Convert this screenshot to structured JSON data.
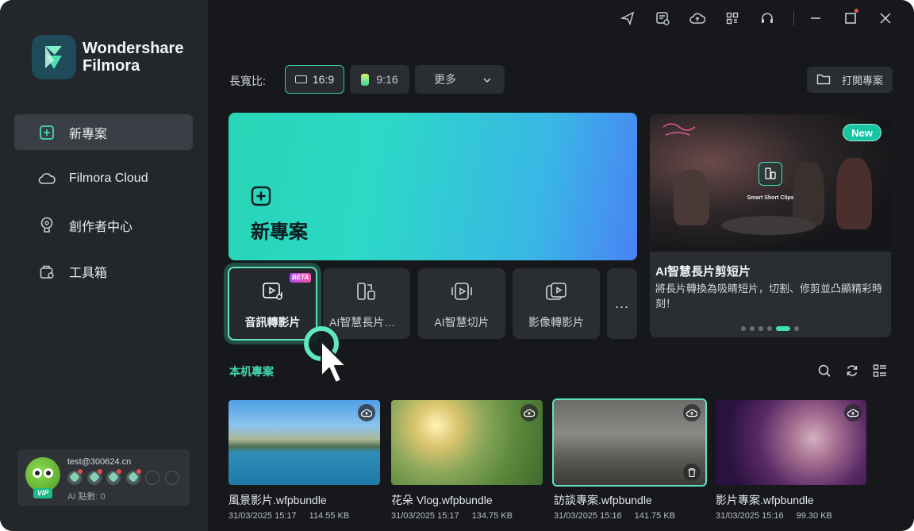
{
  "app": {
    "brand_line1": "Wondershare",
    "brand_line2": "Filmora"
  },
  "sidebar": {
    "items": [
      {
        "label": "新專案",
        "icon": "plus-square-icon",
        "active": true
      },
      {
        "label": "Filmora Cloud",
        "icon": "cloud-icon",
        "active": false
      },
      {
        "label": "創作者中心",
        "icon": "bulb-icon",
        "active": false
      },
      {
        "label": "工具箱",
        "icon": "toolbox-icon",
        "active": false
      }
    ]
  },
  "user": {
    "email": "test@300624.cn",
    "vip_label": "VIP",
    "ai_points": "AI 點數: 0"
  },
  "topbar": {
    "icons": [
      "send-icon",
      "calendar-clock-icon",
      "cloud-sync-icon",
      "grid-icon",
      "headset-icon",
      "minimize-icon",
      "maximize-icon",
      "close-icon"
    ]
  },
  "aspect": {
    "label": "長寬比:",
    "options": [
      "16:9",
      "9:16"
    ],
    "selected": "16:9",
    "more_label": "更多"
  },
  "open_project_label": "打開專案",
  "new_project": {
    "title": "新專案"
  },
  "tools": {
    "items": [
      {
        "label": "音訊轉影片",
        "badge": "BETA",
        "icon": "audio-to-video-icon",
        "selected": true
      },
      {
        "label": "AI智慧長片剪...",
        "icon": "long-video-cut-icon"
      },
      {
        "label": "AI智慧切片",
        "icon": "smart-clip-icon"
      },
      {
        "label": "影像轉影片",
        "icon": "image-to-video-icon"
      }
    ],
    "more_label": "..."
  },
  "promo": {
    "tag": "New",
    "center_caption": "Smart Short Clips",
    "title": "AI智慧長片剪短片",
    "description": "將長片轉換為吸睛短片，切割、修剪並凸顯精彩時刻！",
    "slide_count": 7,
    "active_slide": 5
  },
  "local_projects": {
    "title": "本机專案",
    "items": [
      {
        "name": "風景影片.wfpbundle",
        "date": "31/03/2025 15:17",
        "size": "114.55 KB"
      },
      {
        "name": "花朵 Vlog.wfpbundle",
        "date": "31/03/2025 15:17",
        "size": "134.75 KB"
      },
      {
        "name": "訪談專案.wfpbundle",
        "date": "31/03/2025 15:16",
        "size": "141.75 KB"
      },
      {
        "name": "影片專案.wfpbundle",
        "date": "31/03/2025 15:16",
        "size": "99.30 KB"
      }
    ]
  },
  "colors": {
    "accent": "#3fe2b8",
    "background": "#16181b",
    "sidebar": "#23262b"
  }
}
